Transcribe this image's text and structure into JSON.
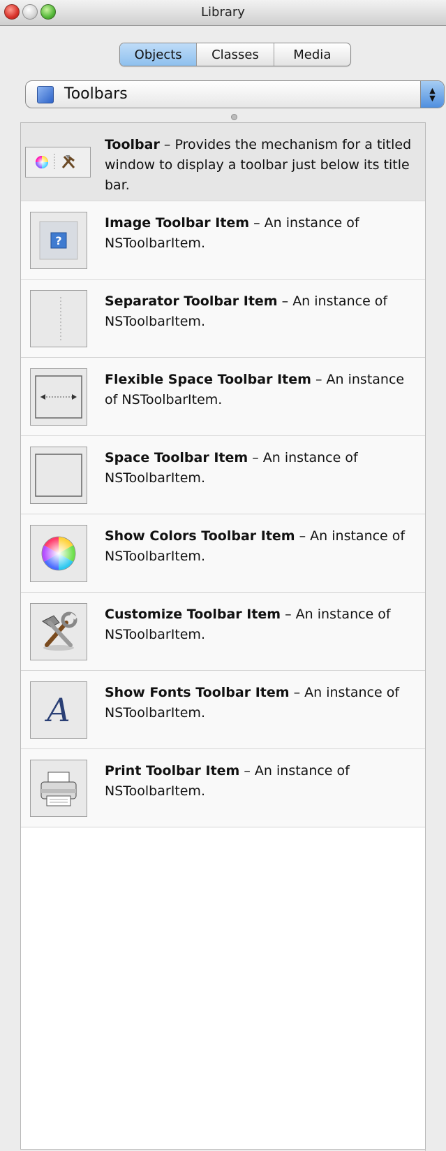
{
  "window": {
    "title": "Library"
  },
  "tabs": [
    {
      "label": "Objects",
      "active": true
    },
    {
      "label": "Classes",
      "active": false
    },
    {
      "label": "Media",
      "active": false
    }
  ],
  "category_popup": {
    "selected": "Toolbars",
    "icon": "folder-blue-icon"
  },
  "items": [
    {
      "name": "Toolbar",
      "description": " – Provides the mechanism for a titled window to display a toolbar just below its title bar.",
      "icon": "toolbar-icon",
      "selected": true
    },
    {
      "name": "Image Toolbar Item",
      "description": " – An instance of NSToolbarItem.",
      "icon": "image-item-icon"
    },
    {
      "name": "Separator Toolbar Item",
      "description": " – An instance of NSToolbarItem.",
      "icon": "separator-icon"
    },
    {
      "name": "Flexible Space Toolbar Item",
      "description": " – An instance of NSToolbarItem.",
      "icon": "flexible-space-icon"
    },
    {
      "name": "Space Toolbar Item",
      "description": " – An instance of NSToolbarItem.",
      "icon": "space-icon"
    },
    {
      "name": "Show Colors Toolbar Item",
      "description": " – An instance of NSToolbarItem.",
      "icon": "color-wheel-icon"
    },
    {
      "name": "Customize Toolbar Item",
      "description": " – An instance of NSToolbarItem.",
      "icon": "tools-icon"
    },
    {
      "name": "Show Fonts Toolbar Item",
      "description": " – An instance of NSToolbarItem.",
      "icon": "font-icon",
      "glyph": "A"
    },
    {
      "name": "Print Toolbar Item",
      "description": " – An instance of NSToolbarItem.",
      "icon": "printer-icon"
    }
  ],
  "colors": {
    "selected_tab": "#8ec0ee",
    "popup_stepper": "#4f8fdf",
    "close": "#d8322a",
    "zoom": "#55b83a"
  }
}
